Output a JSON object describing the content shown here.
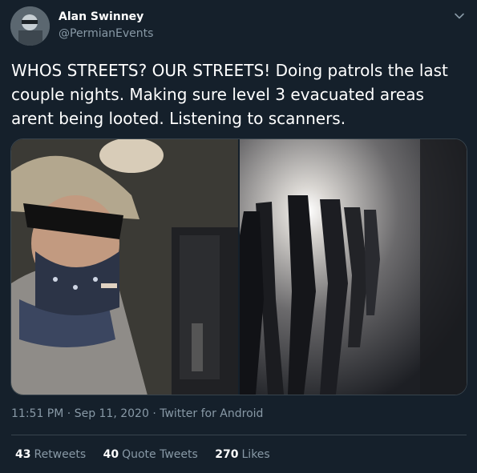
{
  "author": {
    "name": "Alan Swinney",
    "handle": "@PermianEvents"
  },
  "tweet": {
    "text": "WHOS STREETS? OUR STREETS! Doing patrols the last\ncouple nights. Making sure level 3 evacuated areas\narent being looted. Listening to scanners.",
    "time": "11:51 PM",
    "separator1": "·",
    "date": "Sep 11, 2020",
    "separator2": "·",
    "source": "Twitter for Android"
  },
  "stats": {
    "retweets_count": "43",
    "retweets_label": "Retweets",
    "quotes_count": "40",
    "quotes_label": "Quote Tweets",
    "likes_count": "270",
    "likes_label": "Likes"
  },
  "icons": {
    "more": "chevron-down-icon"
  },
  "colors": {
    "background": "#15202b",
    "secondary_text": "#8899a6",
    "divider": "#38444d"
  }
}
